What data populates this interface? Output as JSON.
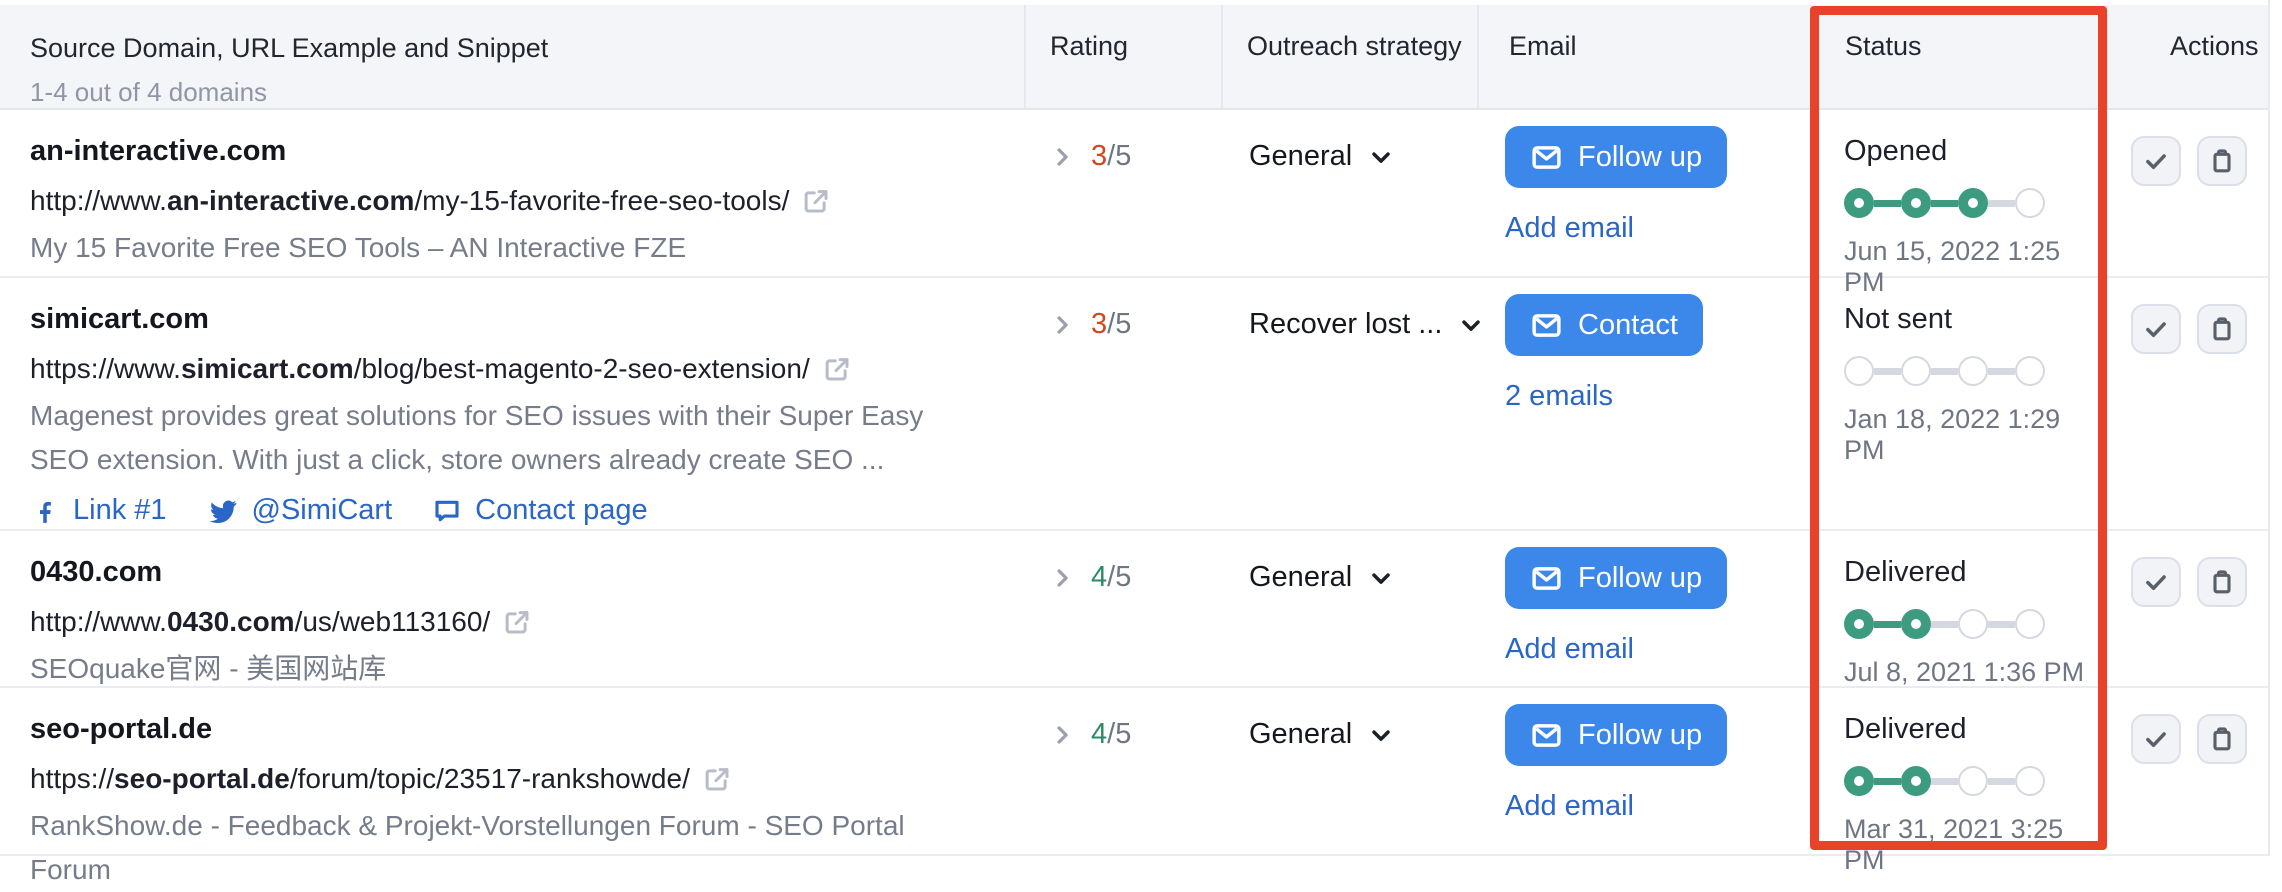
{
  "table": {
    "header": {
      "title": "Source Domain, URL Example and Snippet",
      "subtitle": "1-4 out of 4 domains",
      "rating": "Rating",
      "outreach": "Outreach strategy",
      "email": "Email",
      "status": "Status",
      "actions": "Actions"
    },
    "rows": [
      {
        "domain": "an-interactive.com",
        "url_prefix": "http://www.",
        "url_domain": "an-interactive.com",
        "url_path": "/my-15-favorite-free-seo-tools/",
        "snippet": "My 15 Favorite Free SEO Tools – AN Interactive FZE",
        "rating_value": "3",
        "rating_total": "/5",
        "rating_color": "#cc4a21",
        "strategy": "General",
        "email_button": "Follow up",
        "email_link": "Add email",
        "status_label": "Opened",
        "status_filled": 3,
        "status_date": "Jun 15, 2022 1:25 PM"
      },
      {
        "domain": "simicart.com",
        "url_prefix": "https://www.",
        "url_domain": "simicart.com",
        "url_path": "/blog/best-magento-2-seo-extension/",
        "snippet": "Magenest provides great solutions for SEO issues with their Super Easy SEO extension. With just a click, store owners already create SEO ...",
        "links": [
          {
            "icon": "facebook",
            "label": "Link #1"
          },
          {
            "icon": "twitter",
            "label": "@SimiCart"
          },
          {
            "icon": "contact-page",
            "label": "Contact page"
          }
        ],
        "rating_value": "3",
        "rating_total": "/5",
        "rating_color": "#cc4a21",
        "strategy": "Recover lost ...",
        "email_button": "Contact",
        "email_link": "2 emails",
        "status_label": "Not sent",
        "status_filled": 0,
        "status_date": "Jan 18, 2022 1:29 PM"
      },
      {
        "domain": "0430.com",
        "url_prefix": "http://www.",
        "url_domain": "0430.com",
        "url_path": "/us/web113160/",
        "snippet": "SEOquake官网 - 美国网站库",
        "rating_value": "4",
        "rating_total": "/5",
        "rating_color": "#2c8a64",
        "strategy": "General",
        "email_button": "Follow up",
        "email_link": "Add email",
        "status_label": "Delivered",
        "status_filled": 2,
        "status_date": "Jul 8, 2021 1:36 PM"
      },
      {
        "domain": "seo-portal.de",
        "url_prefix": "https://",
        "url_domain": "seo-portal.de",
        "url_path": "/forum/topic/23517-rankshowde/",
        "snippet": "RankShow.de - Feedback & Projekt-Vorstellungen Forum - SEO Portal Forum",
        "rating_value": "4",
        "rating_total": "/5",
        "rating_color": "#2c8a64",
        "strategy": "General",
        "email_button": "Follow up",
        "email_link": "Add email",
        "status_label": "Delivered",
        "status_filled": 2,
        "status_date": "Mar 31, 2021 3:25 PM"
      }
    ],
    "annotation": {
      "type": "highlight-box",
      "column": "Status",
      "color": "#e8432a"
    },
    "colors": {
      "primary_button": "#3b87ea",
      "link": "#2a65c8",
      "progress_filled": "#3d9c80",
      "progress_empty": "#d5d8e1",
      "rating_low": "#cc4a21",
      "rating_high": "#2c8a64",
      "header_bg": "#f4f5f9"
    }
  }
}
